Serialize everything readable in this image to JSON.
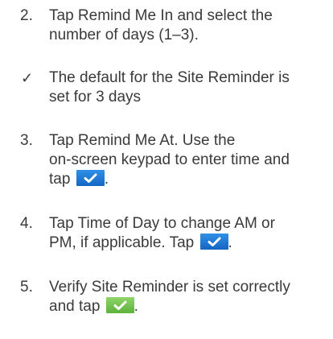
{
  "steps": [
    {
      "number": "2.",
      "line1_pre": "Tap ",
      "line1_bold": "Remind Me In",
      "line1_post": " and select the",
      "line2": "number of days (1–3)."
    },
    {
      "marker": "✓",
      "line1": "The default for the Site Reminder is",
      "line2": "set for 3 days"
    },
    {
      "number": "3.",
      "line1_pre": "Tap ",
      "line1_bold": "Remind Me At",
      "line1_post": ". Use the",
      "line2": "on-screen keypad to enter time and",
      "line3_pre": "tap ",
      "line3_post": ".",
      "button": {
        "icon": "checkmark-icon",
        "color": "#1f7bd8"
      }
    },
    {
      "number": "4.",
      "line1_pre": "Tap ",
      "line1_bold": "Time of Day",
      "line1_post": " to change AM or",
      "line2_pre": "PM, if applicable. Tap ",
      "line2_post": ".",
      "button": {
        "icon": "checkmark-icon",
        "color": "#1f7bd8"
      }
    },
    {
      "number": "5.",
      "line1": "Verify Site Reminder is set correctly",
      "line2_pre": "and tap ",
      "line2_post": ".",
      "button": {
        "icon": "checkmark-icon",
        "color": "#74c44f"
      }
    }
  ]
}
